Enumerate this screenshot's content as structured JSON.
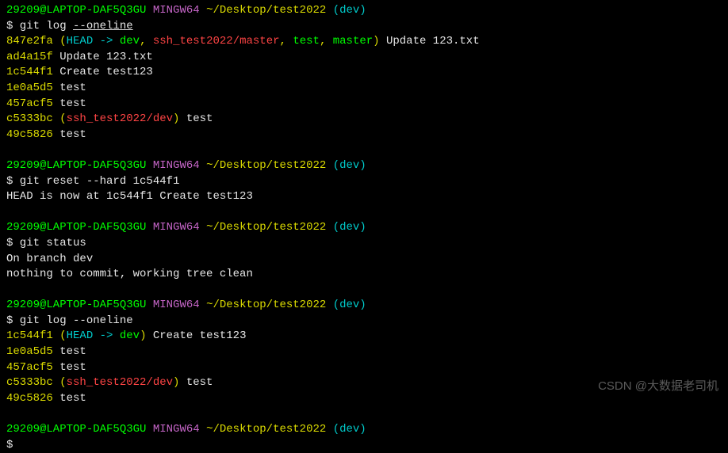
{
  "prompt": {
    "user_host": "29209@LAPTOP-DAF5Q3GU",
    "shell": "MINGW64",
    "path": "~/Desktop/test2022",
    "branch": "(dev)"
  },
  "s1": {
    "cmd_prefix": "$ git log ",
    "cmd_flag": "--oneline",
    "l1_hash": "847e2fa",
    "l1_p1": " (",
    "l1_head": "HEAD -> ",
    "l1_dev": "dev",
    "l1_c1": ", ",
    "l1_remote": "ssh_test2022/master",
    "l1_c2": ", ",
    "l1_test": "test",
    "l1_c3": ", ",
    "l1_master": "master",
    "l1_p2": ")",
    "l1_msg": " Update 123.txt",
    "l2_hash": "ad4a15f",
    "l2_msg": " Update 123.txt",
    "l3_hash": "1c544f1",
    "l3_msg": " Create test123",
    "l4_hash": "1e0a5d5",
    "l4_msg": " test",
    "l5_hash": "457acf5",
    "l5_msg": " test",
    "l6_hash": "c5333bc",
    "l6_p1": " (",
    "l6_remote": "ssh_test2022/dev",
    "l6_p2": ")",
    "l6_msg": " test",
    "l7_hash": "49c5826",
    "l7_msg": " test"
  },
  "s2": {
    "cmd": "$ git reset --hard 1c544f1",
    "out": "HEAD is now at 1c544f1 Create test123"
  },
  "s3": {
    "cmd": "$ git status",
    "out1": "On branch dev",
    "out2": "nothing to commit, working tree clean"
  },
  "s4": {
    "cmd": "$ git log --oneline",
    "l1_hash": "1c544f1",
    "l1_p1": " (",
    "l1_head": "HEAD -> ",
    "l1_dev": "dev",
    "l1_p2": ")",
    "l1_msg": " Create test123",
    "l2_hash": "1e0a5d5",
    "l2_msg": " test",
    "l3_hash": "457acf5",
    "l3_msg": " test",
    "l4_hash": "c5333bc",
    "l4_p1": " (",
    "l4_remote": "ssh_test2022/dev",
    "l4_p2": ")",
    "l4_msg": " test",
    "l5_hash": "49c5826",
    "l5_msg": " test"
  },
  "s5": {
    "cmd": "$"
  },
  "watermark": "CSDN @大数据老司机"
}
